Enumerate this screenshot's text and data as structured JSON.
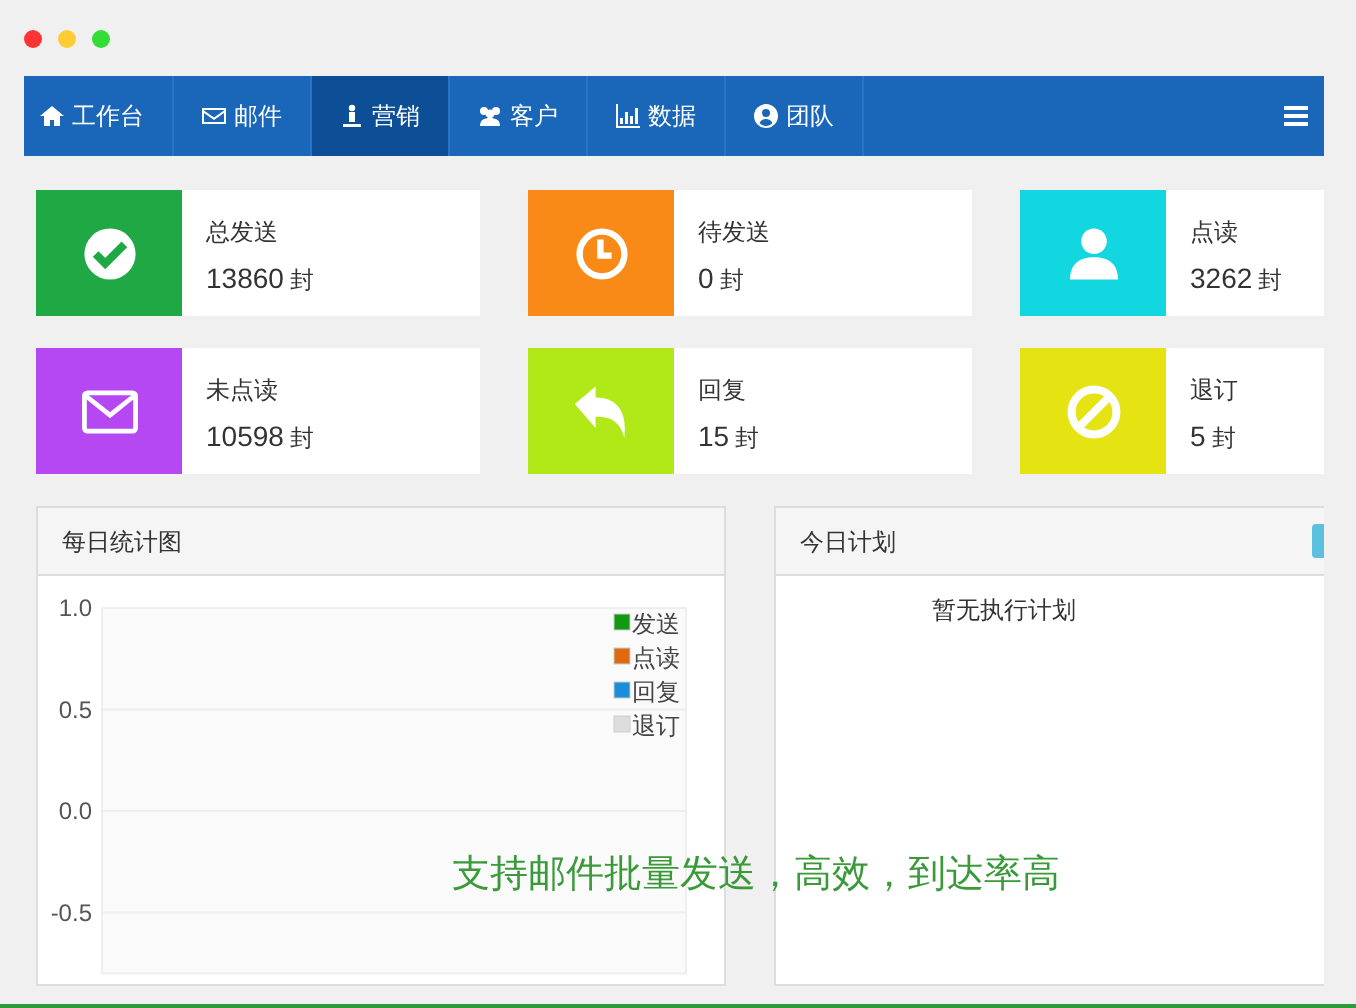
{
  "nav": {
    "items": [
      {
        "label": "工作台",
        "selected": false
      },
      {
        "label": "邮件",
        "selected": false
      },
      {
        "label": "营销",
        "selected": true
      },
      {
        "label": "客户",
        "selected": false
      },
      {
        "label": "数据",
        "selected": false
      },
      {
        "label": "团队",
        "selected": false
      }
    ]
  },
  "stats": [
    {
      "label": "总发送",
      "count": "13860",
      "unit": "封",
      "color": "#1fa844"
    },
    {
      "label": "待发送",
      "count": "0",
      "unit": "封",
      "color": "#f98a17"
    },
    {
      "label": "点读",
      "count": "3262",
      "unit": "封",
      "color": "#12d6e0"
    },
    {
      "label": "未点读",
      "count": "10598",
      "unit": "封",
      "color": "#b648f4"
    },
    {
      "label": "回复",
      "count": "15",
      "unit": "封",
      "color": "#b1e817"
    },
    {
      "label": "退订",
      "count": "5",
      "unit": "封",
      "color": "#e6e312"
    }
  ],
  "daily_chart": {
    "title": "每日统计图",
    "chart_data": {
      "type": "line",
      "grid": true,
      "yticks": [
        {
          "value": 1,
          "label": "1.0"
        },
        {
          "value": 0.5,
          "label": "0.5"
        },
        {
          "value": 0,
          "label": "0.0"
        },
        {
          "value": -0.5,
          "label": "-0.5"
        }
      ],
      "ylim": [
        -0.8,
        1
      ],
      "series": [
        {
          "name": "发送",
          "color": "#119911"
        },
        {
          "name": "点读",
          "color": "#e06a10"
        },
        {
          "name": "回复",
          "color": "#1a8fd8"
        },
        {
          "name": "退订",
          "color": "#dddddd"
        }
      ]
    }
  },
  "today_plan": {
    "title": "今日计划",
    "message": "暂无执行计划"
  },
  "caption": "支持邮件批量发送，高效，到达率高"
}
